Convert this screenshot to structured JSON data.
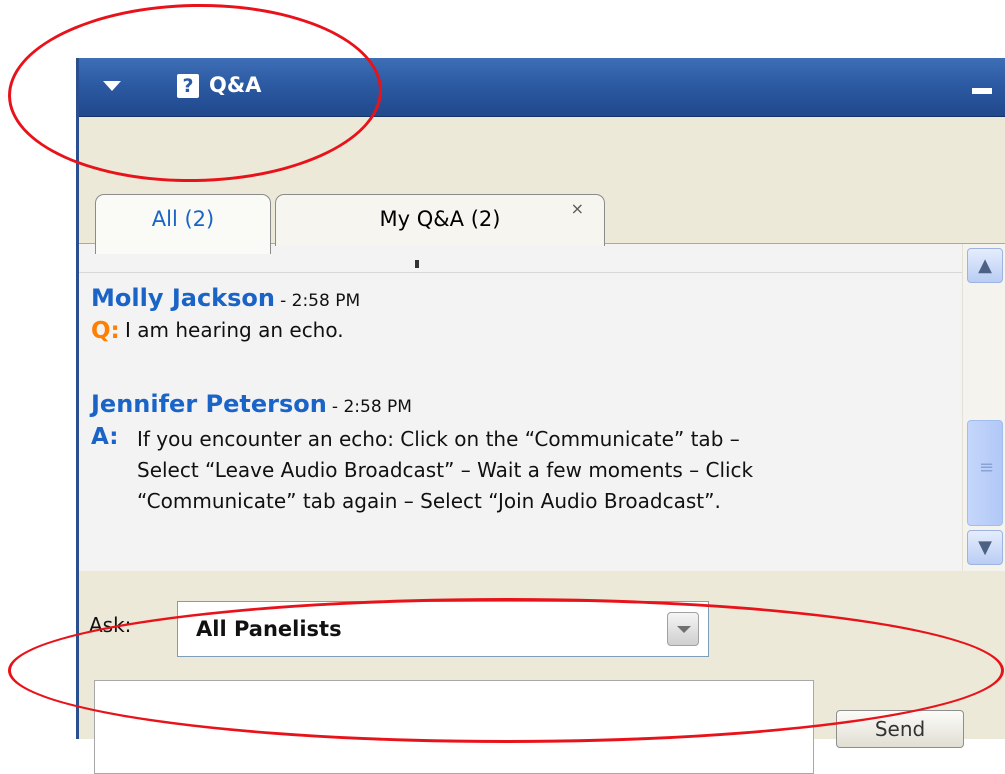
{
  "panel": {
    "title": "Q&A",
    "help_glyph": "?",
    "icons": [
      "collapse-arrow-icon",
      "help-icon",
      "minimize-icon"
    ]
  },
  "tabs": [
    {
      "label": "All (2)",
      "active": true
    },
    {
      "label": "My Q&A (2)",
      "active": false,
      "close_glyph": "×"
    }
  ],
  "messages": [
    {
      "author": "Molly Jackson",
      "time": "- 2:58 PM",
      "type_label": "Q:",
      "text": "I am hearing an echo."
    },
    {
      "author": "Jennifer Peterson",
      "time": "- 2:58 PM",
      "type_label": "A:",
      "text_lines": [
        "If you encounter an echo: Click on the “Communicate” tab –",
        "Select “Leave Audio Broadcast” – Wait a few moments – Click",
        "“Communicate” tab again – Select “Join Audio Broadcast”."
      ]
    }
  ],
  "ask": {
    "label": "Ask:",
    "selected": "All Panelists"
  },
  "compose": {
    "placeholder": "",
    "send_label": "Send"
  },
  "colors": {
    "titlebar": "#2c5aa3",
    "author": "#1a64c8",
    "question_label": "#ff7f00",
    "annotation": "#e8131a"
  }
}
